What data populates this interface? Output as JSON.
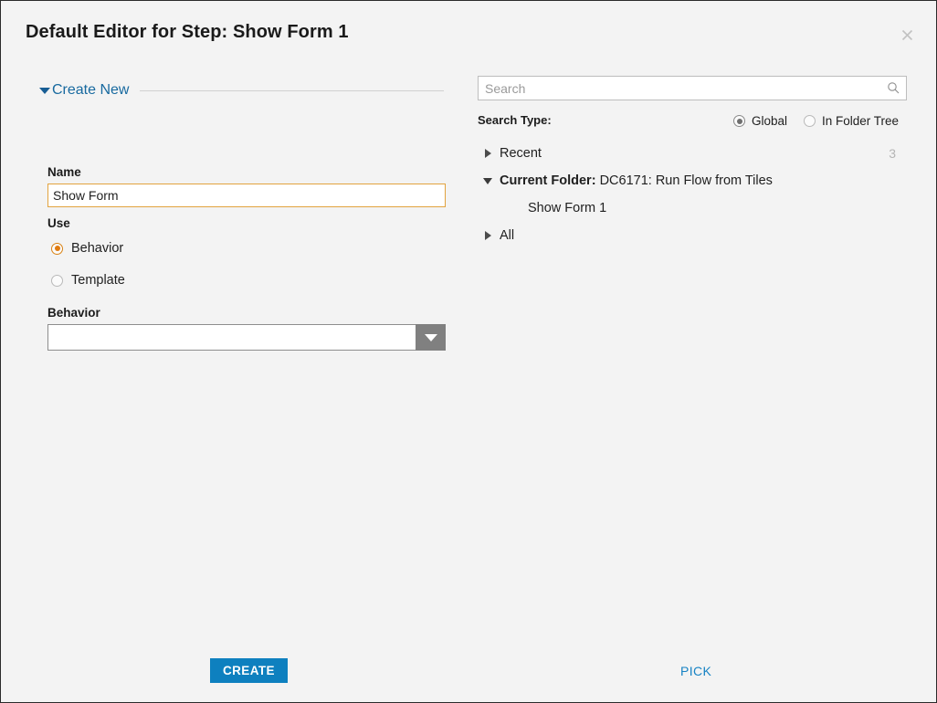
{
  "dialog": {
    "title": "Default Editor for Step: Show Form 1",
    "close_icon": "close-icon"
  },
  "left_pane": {
    "section": {
      "title": "Create New",
      "expanded": true
    },
    "name": {
      "label": "Name",
      "value": "Show Form",
      "placeholder": ""
    },
    "use": {
      "label": "Use",
      "options": [
        {
          "label": "Behavior",
          "selected": true
        },
        {
          "label": "Template",
          "selected": false
        }
      ]
    },
    "behavior": {
      "label": "Behavior",
      "value": "",
      "dropdown_icon": "chevron-down-icon"
    }
  },
  "right_pane": {
    "search": {
      "value": "",
      "placeholder": "Search",
      "icon": "search-icon"
    },
    "search_type": {
      "label": "Search Type:",
      "options": [
        {
          "label": "Global",
          "selected": true
        },
        {
          "label": "In Folder Tree",
          "selected": false
        }
      ]
    },
    "tree": [
      {
        "label": "Recent",
        "count": "3",
        "state": "collapsed",
        "bold_prefix": "",
        "child": false
      },
      {
        "label": "DC6171: Run Flow from Tiles",
        "bold_prefix": "Current Folder:",
        "count": "",
        "state": "expanded",
        "child": false
      },
      {
        "label": "Show Form 1",
        "bold_prefix": "",
        "count": "",
        "state": "leaf",
        "child": true
      },
      {
        "label": "All",
        "count": "",
        "state": "collapsed",
        "bold_prefix": "",
        "child": false
      }
    ]
  },
  "footer": {
    "create_label": "CREATE",
    "pick_label": "PICK"
  },
  "colors": {
    "accent_blue": "#0e80bf",
    "link_blue": "#1783c4",
    "section_blue": "#17699f",
    "focus_orange": "#e2a33f",
    "radio_orange": "#e07b10",
    "background": "#f3f3f3",
    "border": "#2b2b2b"
  }
}
